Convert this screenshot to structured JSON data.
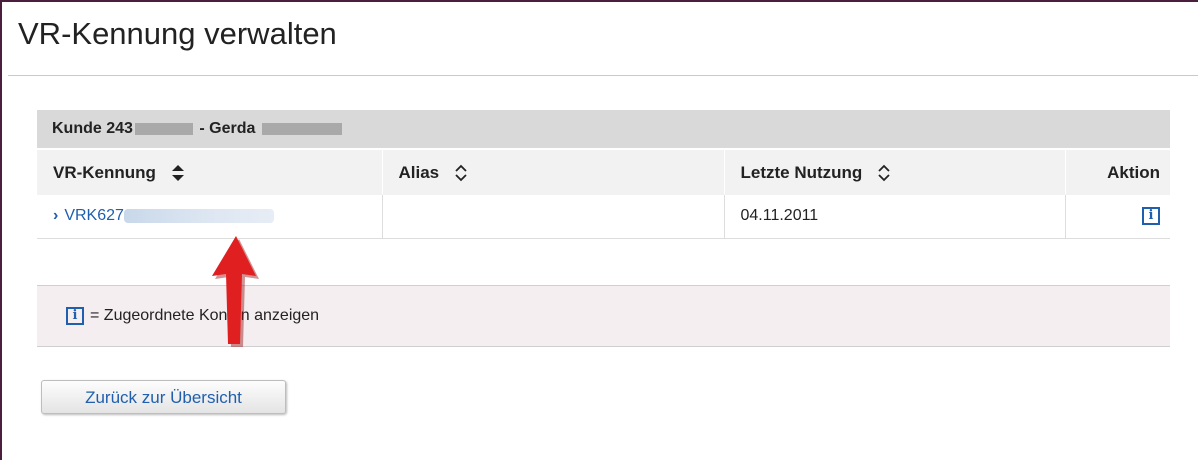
{
  "page": {
    "title": "VR-Kennung verwalten"
  },
  "customer": {
    "prefix": "Kunde 243",
    "separator": " - Gerda "
  },
  "table": {
    "headers": [
      {
        "label": "VR-Kennung",
        "sortable": true,
        "sort_state": "active"
      },
      {
        "label": "Alias",
        "sortable": true,
        "sort_state": "inactive"
      },
      {
        "label": "Letzte Nutzung",
        "sortable": true,
        "sort_state": "inactive"
      },
      {
        "label": "Aktion",
        "sortable": false
      }
    ],
    "rows": [
      {
        "vr_kennung": "VRK627",
        "alias": "",
        "letzte_nutzung": "04.11.2011",
        "aktion_icon": "info-icon"
      }
    ]
  },
  "legend": {
    "icon": "info-icon",
    "icon_glyph": "i",
    "text": "= Zugeordnete Konten anzeigen"
  },
  "buttons": {
    "back_label": "Zurück zur Übersicht"
  },
  "colors": {
    "link": "#1f5fae",
    "header_bg": "#d9d9d9",
    "annotation_arrow": "#e02020"
  }
}
